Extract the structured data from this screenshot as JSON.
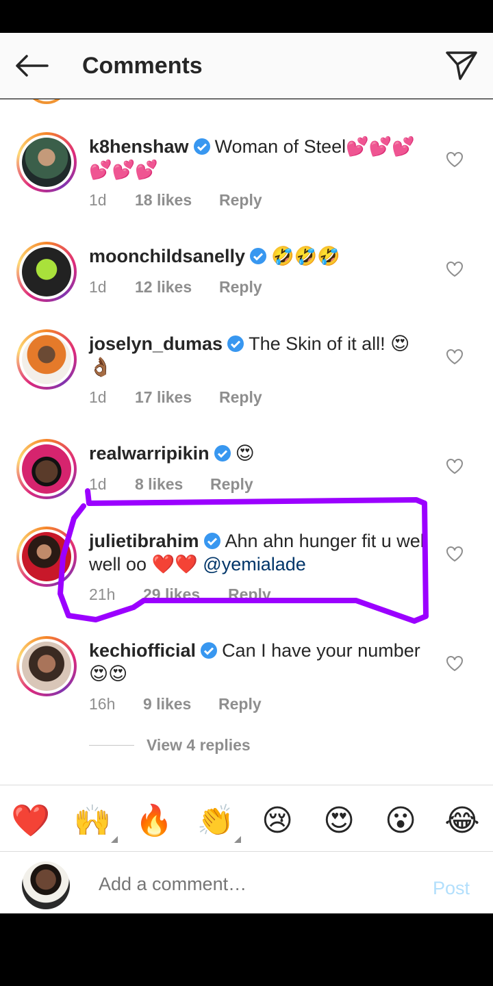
{
  "header": {
    "title": "Comments"
  },
  "comments": [
    {
      "username": "k8henshaw",
      "text": "Woman of Steel💕💕💕💕💕💕",
      "time": "1d",
      "likes": "18 likes",
      "reply": "Reply"
    },
    {
      "username": "moonchildsanelly",
      "text": "🤣🤣🤣",
      "time": "1d",
      "likes": "12 likes",
      "reply": "Reply"
    },
    {
      "username": "joselyn_dumas",
      "text": "The Skin of it all! 😍👌🏾",
      "time": "1d",
      "likes": "17 likes",
      "reply": "Reply"
    },
    {
      "username": "realwarripikin",
      "text": "😍",
      "time": "1d",
      "likes": "8 likes",
      "reply": "Reply"
    },
    {
      "username": "julietibrahim",
      "text": "Ahn ahn hunger fit u well well oo ❤️❤️ ",
      "mention": "@yemialade",
      "time": "21h",
      "likes": "29 likes",
      "reply": "Reply"
    },
    {
      "username": "kechiofficial",
      "text": "Can I have your number 😍😍",
      "time": "16h",
      "likes": "9 likes",
      "reply": "Reply"
    }
  ],
  "view_replies": "View 4 replies",
  "emoji_bar": [
    "❤️",
    "🙌",
    "🔥",
    "👏",
    "😢",
    "😍",
    "😮",
    "😂"
  ],
  "compose": {
    "placeholder": "Add a comment…",
    "post_label": "Post"
  },
  "colors": {
    "highlight": "#9b00ff",
    "verified": "#3897f0",
    "post": "#b2dffc"
  }
}
